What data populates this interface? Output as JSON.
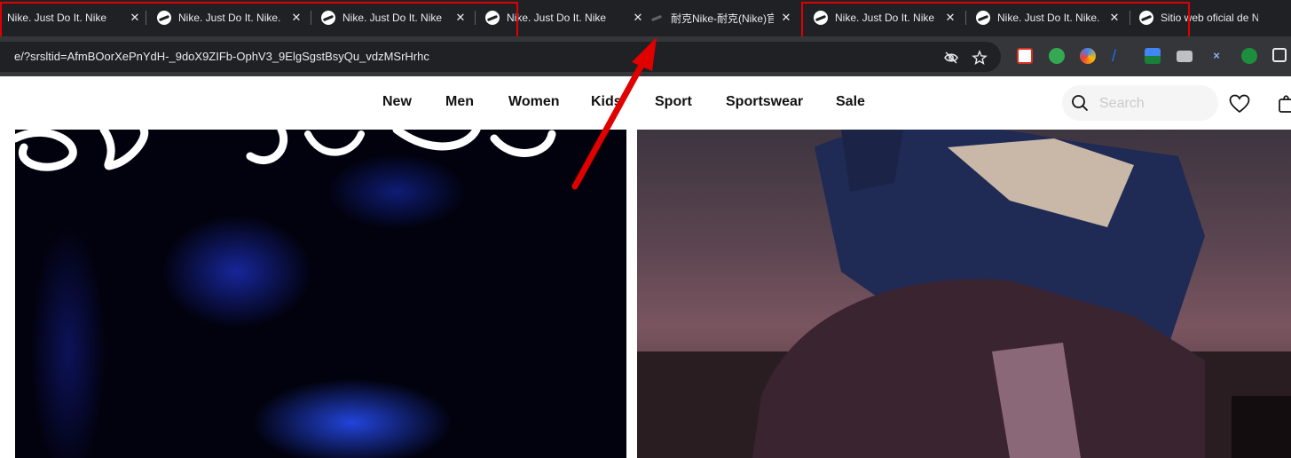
{
  "browser": {
    "tabs": [
      {
        "title": "Nike. Just Do It. Nike",
        "favicon": "nike-swoosh-icon",
        "active": false
      },
      {
        "title": "Nike. Just Do It. Nike.",
        "favicon": "nike-swoosh-icon",
        "active": false
      },
      {
        "title": "Nike. Just Do It. Nike",
        "favicon": "nike-swoosh-icon",
        "active": false
      },
      {
        "title": "Nike. Just Do It. Nike",
        "favicon": "nike-swoosh-icon",
        "active": false
      },
      {
        "title": "耐克Nike-耐克(Nike)官",
        "favicon": "nike-swoosh-icon",
        "active": false
      },
      {
        "title": "Nike. Just Do It. Nike",
        "favicon": "nike-swoosh-icon",
        "active": false
      },
      {
        "title": "Nike. Just Do It. Nike.",
        "favicon": "nike-swoosh-icon",
        "active": false
      },
      {
        "title": "Sitio web oficial de Nike",
        "favicon": "nike-swoosh-icon",
        "active": false
      }
    ],
    "tab_close_glyph": "✕",
    "url": "e/?srsltid=AfmBOorXePnYdH-_9doX9ZIFb-OphV3_9ElgSgstBsyQu_vdzMSrHrhc",
    "toolbar_icons": [
      "eye-off-icon",
      "star-icon"
    ],
    "extensions": [
      {
        "name": "calendar-extension-icon",
        "color": "#d93025"
      },
      {
        "name": "green-circle-extension-icon",
        "color": "#34a853"
      },
      {
        "name": "colorful-extension-icon",
        "color": "#fbbc04"
      },
      {
        "name": "blue-slash-extension-icon",
        "color": "#1a73e8"
      },
      {
        "name": "landscape-extension-icon",
        "color": "#188038"
      },
      {
        "name": "camera-extension-icon",
        "color": "#bdc1c6"
      },
      {
        "name": "x-extension-icon",
        "color": "#8ab4f8"
      },
      {
        "name": "green-face-extension-icon",
        "color": "#1e8e3e"
      },
      {
        "name": "puzzle-extensions-icon",
        "color": "#e8eaed"
      }
    ],
    "highlight_color": "#e00000"
  },
  "site": {
    "nav": [
      "New",
      "Men",
      "Women",
      "Kids",
      "Sport",
      "Sportswear",
      "Sale"
    ],
    "search": {
      "placeholder": "Search"
    },
    "icons": [
      "search-icon",
      "heart-icon",
      "bag-icon"
    ]
  }
}
